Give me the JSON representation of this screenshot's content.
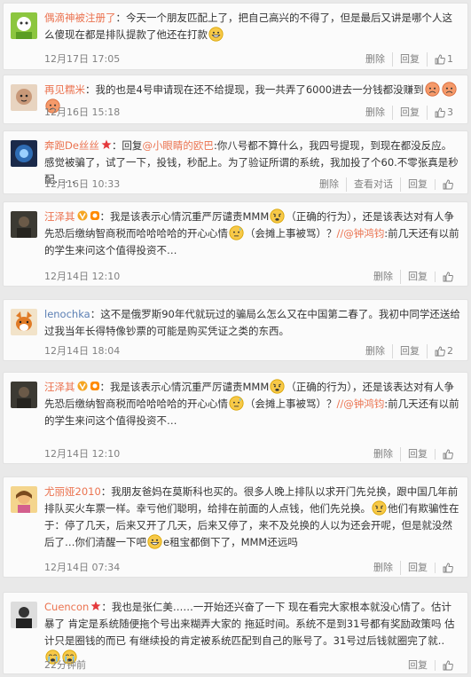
{
  "comments": [
    {
      "user": "偶滴神被注册了",
      "text_before": "：今天一个朋友匹配上了，把自己高兴的不得了，但是最后又讲是哪个人这么傻现在都是排队提款了他还在打款",
      "time": "12月17日 17:05",
      "actions": [
        "删除",
        "回复"
      ],
      "likes": "1"
    },
    {
      "user": "再见糯米",
      "text_before": "：我的也是4号申请现在还不给提现，我一共弄了6000进去一分钱都没赚到",
      "time": "12月16日 15:18",
      "actions": [
        "删除",
        "回复"
      ],
      "likes": "3"
    },
    {
      "user": "奔跑De丝丝",
      "text_pre_mention": "：回复",
      "mention": "@小眼睛的欧巴",
      "text_after_mention": ":你八号都不算什么，我四号提现，到现在都没反应。感觉被骗了，试了一下，投钱，秒配上。为了验证所谓的系统，我加投了个60.不零张真是秒配……",
      "time": "12月16日 10:33",
      "actions": [
        "删除",
        "查看对话",
        "回复"
      ],
      "likes": ""
    },
    {
      "user": "汪泽其",
      "text_a": "：我是该表示心情沉重严厉谴责MMM",
      "text_b": "（正确的行为），还是该表达对有人争先恐后缴纳智商税而哈哈哈哈的开心心情",
      "text_c": "（会摊上事被骂）？",
      "mention": "//@钟鸿钧",
      "text_d": ":前几天还有以前的学生来问这个值得投资不…",
      "time": "12月14日 12:10",
      "actions": [
        "删除",
        "回复"
      ],
      "likes": ""
    },
    {
      "user": "lenochka",
      "text_before": "：这不是俄罗斯90年代就玩过的骗局么怎么又在中国第二春了。我初中同学还送给过我当年长得特像钞票的可能是购买凭证之类的东西。",
      "time": "12月14日 18:04",
      "actions": [
        "删除",
        "回复"
      ],
      "likes": "2"
    },
    {
      "user": "汪泽其",
      "text_a": "：我是该表示心情沉重严厉谴责MMM",
      "text_b": "（正确的行为），还是该表达对有人争先恐后缴纳智商税而哈哈哈哈的开心心情",
      "text_c": "（会摊上事被骂）？",
      "mention": "//@钟鸿钧",
      "text_d": ":前几天还有以前的学生来问这个值得投资不…",
      "time": "12月14日 12:10",
      "actions": [
        "删除",
        "回复"
      ],
      "likes": ""
    },
    {
      "user": "尤丽娅2010",
      "text_a": "：我朋友爸妈在莫斯科也买的。很多人晚上排队以求开门先兑换，跟中国几年前排队买火车票一样。幸亏他们聪明，给排在前面的人点钱，他们先兑换。",
      "text_b": "他们有欺骗性在于：停了几天，后来又开了几天，后来又停了，来不及兑换的人以为还会开呢，但是就没然后了…你们清醒一下吧",
      "text_c": "e租宝都倒下了，MMM还远吗",
      "time": "12月14日 07:34",
      "actions": [
        "删除",
        "回复"
      ],
      "likes": ""
    },
    {
      "user": "Cuencon",
      "text_before": "：我也是张仁美……一开始还兴奋了一下 现在看完大家根本就没心情了。估计暴了 肯定是系统随便拖个号出来糊弄大家的 拖延时间。系统不是到31号都有奖励政策吗 估计只是圈钱的而已 有继续投的肯定被系统匹配到自己的账号了。31号过后钱就圈完了就..",
      "time": "22分钟前",
      "actions": [
        "回复"
      ],
      "likes": ""
    }
  ],
  "colors": {
    "username": "#eb7350",
    "footer": "#808080",
    "card_bg": "#fbfbfb",
    "page_bg": "#e9e9e9"
  },
  "icons": [
    "avatar",
    "vip-v-icon",
    "red-star-icon",
    "orange-badge-icon",
    "grin-emoji-icon",
    "annoyed-emoji-icon",
    "sweat-emoji-icon",
    "sad-emoji-icon",
    "cry-emoji-icon",
    "thumbs-up-icon"
  ]
}
